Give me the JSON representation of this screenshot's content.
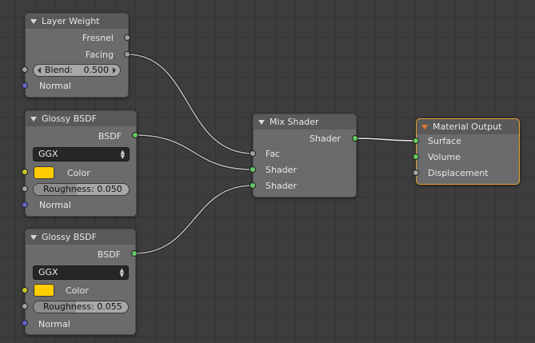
{
  "colors": {
    "background": "#3d3d3d",
    "node_body": "#6b6b6b",
    "node_header": "#595959",
    "active_border": "#e8a030",
    "socket_shader": "#63c763",
    "socket_color": "#c7c729",
    "socket_float": "#a1a1a1",
    "socket_vector": "#6363c7",
    "swatch": "#ffcc00",
    "wire": "#b8b8b8"
  },
  "nodes": {
    "layer_weight": {
      "title": "Layer Weight",
      "out_fresnel": "Fresnel",
      "out_facing": "Facing",
      "blend_label": "Blend:",
      "blend_value": "0.500",
      "in_normal": "Normal"
    },
    "glossy1": {
      "title": "Glossy BSDF",
      "out_bsdf": "BSDF",
      "distribution": "GGX",
      "color_label": "Color",
      "roughness_text": "Roughness: 0.050",
      "roughness_value": 0.05,
      "in_normal": "Normal"
    },
    "glossy2": {
      "title": "Glossy BSDF",
      "out_bsdf": "BSDF",
      "distribution": "GGX",
      "color_label": "Color",
      "roughness_text": "Roughness: 0.055",
      "roughness_value": 0.055,
      "in_normal": "Normal"
    },
    "mix": {
      "title": "Mix Shader",
      "out_shader": "Shader",
      "in_fac": "Fac",
      "in_shader1": "Shader",
      "in_shader2": "Shader"
    },
    "output": {
      "title": "Material Output",
      "in_surface": "Surface",
      "in_volume": "Volume",
      "in_displacement": "Displacement"
    }
  }
}
